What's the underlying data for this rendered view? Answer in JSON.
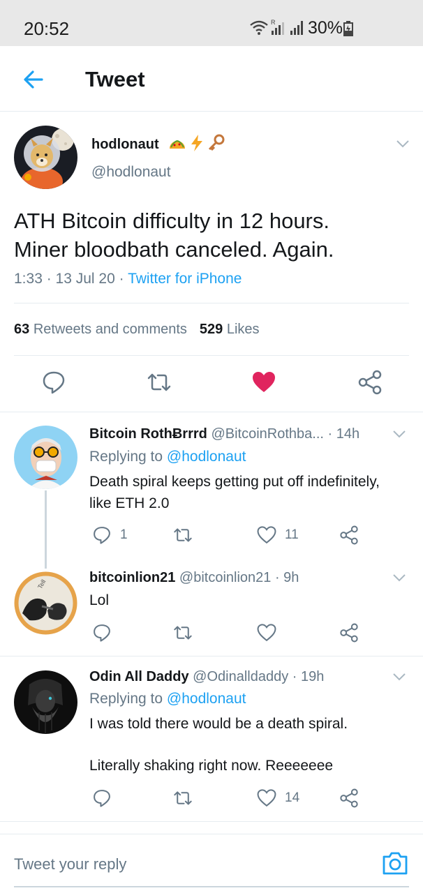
{
  "status_bar": {
    "time": "20:52",
    "battery": "30%"
  },
  "header": {
    "title": "Tweet",
    "back_icon": "back-arrow-icon"
  },
  "main_tweet": {
    "name": "hodlonaut",
    "handle": "@hodlonaut",
    "text_line1": "ATH Bitcoin difficulty in 12 hours.",
    "text_line2": "Miner bloodbath canceled. Again.",
    "time": "1:33 · 13 Jul 20 · ",
    "source": "Twitter for iPhone",
    "retweets_count": "63",
    "retweets_label": "Retweets and comments",
    "likes_count": "529",
    "likes_label": "Likes",
    "liked": true,
    "colors": {
      "like": "#e0245e",
      "link": "#1da1f2"
    }
  },
  "replies": [
    {
      "name": "Bitcoin RothɃrrrd",
      "handle": "@BitcoinRothba... · 14h",
      "replying_prefix": "Replying to ",
      "replying_to": "@hodlonaut",
      "text_line1": "Death spiral keeps getting put off indefinitely,",
      "text_line2": "like ETH 2.0",
      "reply_count": "1",
      "like_count": "11"
    },
    {
      "name": "bitcoinlion21",
      "handle": "@bitcoinlion21 · 9h",
      "text_line1": "Lol"
    },
    {
      "name": "Odin All Daddy",
      "handle": "@Odinalldaddy · 19h",
      "replying_prefix": "Replying to ",
      "replying_to": "@hodlonaut",
      "text_line1": "I was told there would be a death spiral.",
      "text_line2": "Literally shaking right now. Reeeeeee",
      "like_count": "14"
    }
  ],
  "compose": {
    "placeholder": "Tweet your reply"
  }
}
